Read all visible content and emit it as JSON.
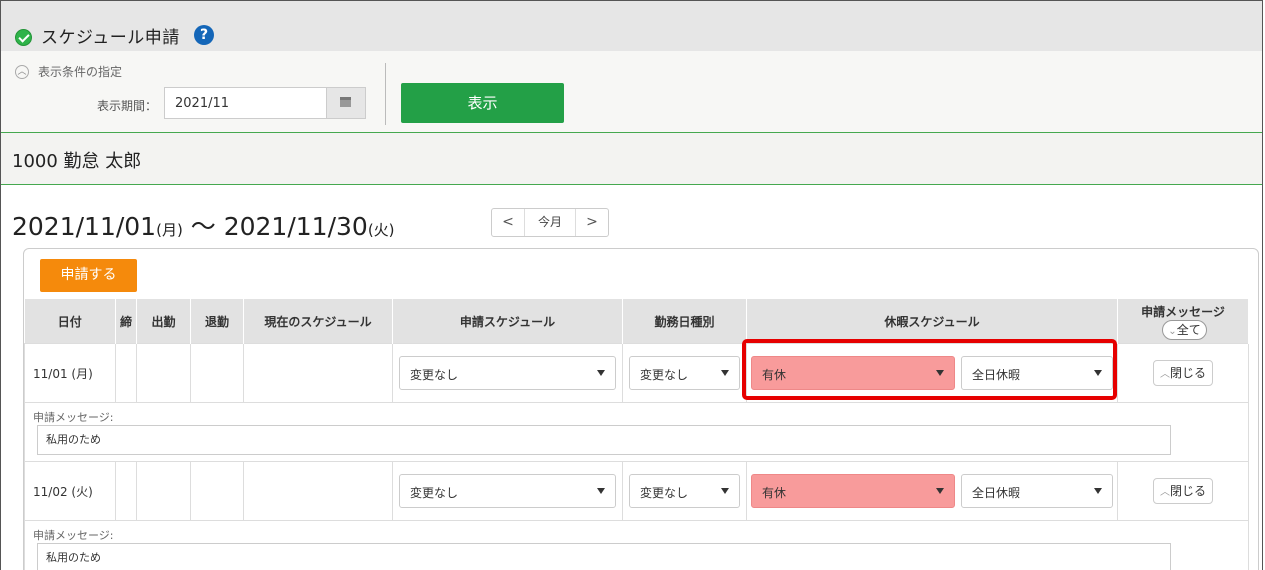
{
  "header": {
    "title": "スケジュール申請",
    "help_glyph": "?"
  },
  "conditions": {
    "toggle_label": "表示条件の指定",
    "period_label": "表示期間：",
    "period_value": "2021/11",
    "show_button": "表示"
  },
  "employee": {
    "name": "1000 勤怠 太郎"
  },
  "range": {
    "start": "2021/11/01",
    "start_dow": "(月)",
    "separator": " 〜 ",
    "end": "2021/11/30",
    "end_dow": "(火)",
    "prev": "<",
    "today": "今月",
    "next": ">"
  },
  "apply_button": "申請する",
  "columns": {
    "date": "日付",
    "close": "締",
    "clock_in": "出勤",
    "clock_out": "退勤",
    "current": "現在のスケジュール",
    "requested": "申請スケジュール",
    "day_type": "勤務日種別",
    "leave": "休暇スケジュール",
    "message": "申請メッセージ",
    "all_toggle": "全て"
  },
  "rows": [
    {
      "date": "11/01 (月)",
      "requested": "変更なし",
      "day_type": "変更なし",
      "leave_type": "有休",
      "leave_span": "全日休暇",
      "close_btn": "閉じる",
      "msg_label": "申請メッセージ:",
      "msg_value": "私用のため"
    },
    {
      "date": "11/02 (火)",
      "requested": "変更なし",
      "day_type": "変更なし",
      "leave_type": "有休",
      "leave_span": "全日休暇",
      "close_btn": "閉じる",
      "msg_label": "申請メッセージ:",
      "msg_value": "私用のため"
    }
  ],
  "colors": {
    "accent_green": "#23a047",
    "apply_orange": "#f58a0c",
    "leave_pink": "#f89b9b",
    "highlight_red": "#e60000"
  }
}
